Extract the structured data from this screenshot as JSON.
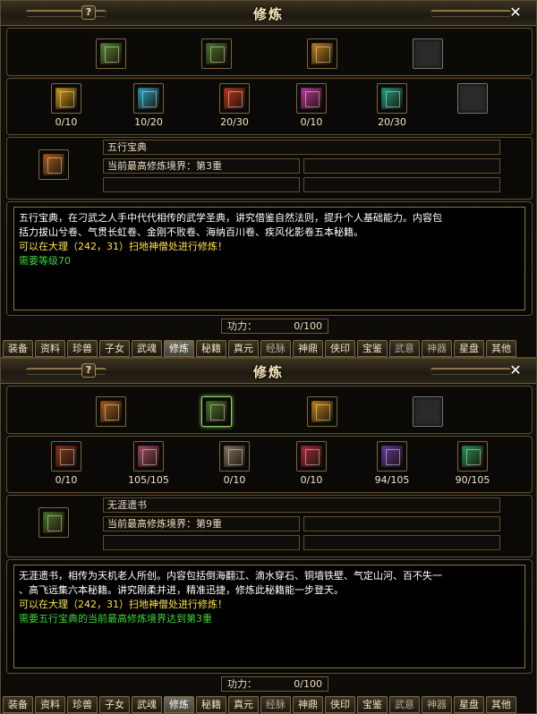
{
  "panels": [
    {
      "title": "修炼",
      "help": "?",
      "close": "✕",
      "top_books": [
        {
          "icon": "book-green-yellow-icon",
          "color": "#5a8f3a",
          "empty": false,
          "selected": false
        },
        {
          "icon": "book-bundle-green-icon",
          "color": "#4d7a2c",
          "empty": false,
          "selected": false
        },
        {
          "icon": "book-gold-icon",
          "color": "#c98a1a",
          "empty": false,
          "selected": false
        },
        {
          "icon": "empty-slot-icon",
          "color": "#2a2a2a",
          "empty": true,
          "selected": false
        }
      ],
      "chapters": [
        {
          "icon": "scroll-yellow-icon",
          "color": "#d9a21a",
          "count": "0/10"
        },
        {
          "icon": "scroll-cyan-icon",
          "color": "#2aa7c9",
          "count": "10/20"
        },
        {
          "icon": "scroll-red-icon",
          "color": "#c8381e",
          "count": "20/30"
        },
        {
          "icon": "scroll-pink-icon",
          "color": "#c23aa0",
          "count": "0/10"
        },
        {
          "icon": "scroll-teal-icon",
          "color": "#1fa68a",
          "count": "20/30"
        },
        {
          "icon": "empty-slot-icon",
          "color": "#2a2a2a",
          "count": ""
        }
      ],
      "selected_book": {
        "icon": "book-green-yellow-icon",
        "color": "#b0621c"
      },
      "name": "五行宝典",
      "realm": "当前最高修炼境界：第3重",
      "desc_white": [
        "五行宝典，在刁武之人手中代代相传的武学圣典，讲究借鉴自然法则，提升个人基础能力。内容包",
        "括力拔山兮卷、气贯长虹卷、金刚不败卷、海纳百川卷、疾风化影卷五本秘籍。"
      ],
      "desc_yellow": "可以在大理（242，31）扫地神僧处进行修炼！",
      "desc_green": "需要等级70",
      "power_label": "功力：",
      "power_value": "0/100"
    },
    {
      "title": "修炼",
      "help": "?",
      "close": "✕",
      "top_books": [
        {
          "icon": "book-green-yellow-icon",
          "color": "#b0621c",
          "empty": false,
          "selected": false
        },
        {
          "icon": "book-bundle-green-icon",
          "color": "#4d7a2c",
          "empty": false,
          "selected": true
        },
        {
          "icon": "book-gold-icon",
          "color": "#c98a1a",
          "empty": false,
          "selected": false
        },
        {
          "icon": "empty-slot-icon",
          "color": "#2a2a2a",
          "empty": true,
          "selected": false
        }
      ],
      "chapters": [
        {
          "icon": "scroll-brown-icon",
          "color": "#8a3a1e",
          "count": "0/10"
        },
        {
          "icon": "scroll-rose-icon",
          "color": "#a8506a",
          "count": "105/105"
        },
        {
          "icon": "scroll-grey-icon",
          "color": "#8a7a6a",
          "count": "0/10"
        },
        {
          "icon": "scroll-crimson-icon",
          "color": "#b22a3a",
          "count": "0/10"
        },
        {
          "icon": "scroll-purple-icon",
          "color": "#6a3aa8",
          "count": "94/105"
        },
        {
          "icon": "scroll-green-icon",
          "color": "#2a9a5a",
          "count": "90/105"
        }
      ],
      "selected_book": {
        "icon": "book-bundle-green-icon",
        "color": "#4d7a2c"
      },
      "name": "无涯遗书",
      "realm": "当前最高修炼境界：第9重",
      "desc_white": [
        "无涯遗书，相传为天机老人所创。内容包括倒海翻江、滴水穿石、铜墙铁壁、气定山河、百不失一",
        "、高飞远集六本秘籍。讲究刚柔并进，精准迅捷，修炼此秘籍能一步登天。"
      ],
      "desc_yellow": "可以在大理（242，31）扫地神僧处进行修炼！",
      "desc_green": "需要五行宝典的当前最高修炼境界达到第3重",
      "power_label": "功力：",
      "power_value": "0/100"
    }
  ],
  "tabs": [
    "装备",
    "资料",
    "珍兽",
    "子女",
    "武魂",
    "修炼",
    "秘籍",
    "真元",
    "经脉",
    "神鼎",
    "侠印",
    "宝鉴",
    "武意",
    "神器",
    "星盘",
    "其他"
  ],
  "active_tab": "修炼"
}
